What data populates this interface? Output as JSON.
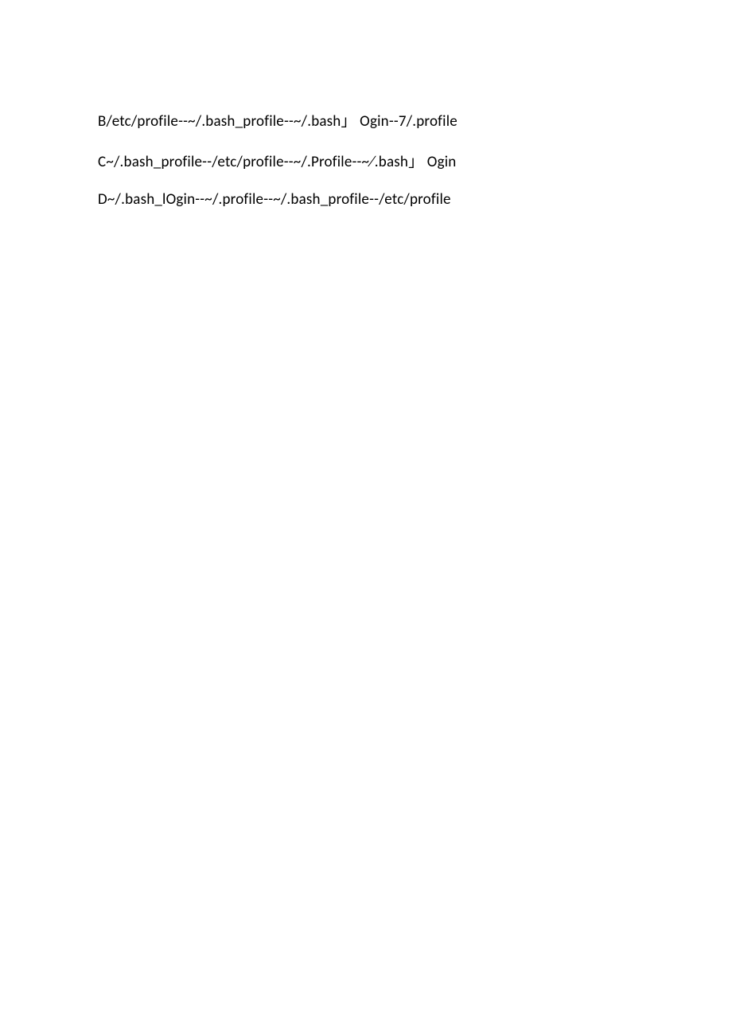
{
  "options": {
    "b": "B/etc/profile--~/.bash_profile--~/.bash」 Ogin--7/.profile",
    "c": "C~/.bash_profile--/etc/profile--~/.Profile--~⁄.bash」 Ogin",
    "d": "D~/.bash_lOgin--~/.profile--~/.bash_profile--/etc/profile"
  }
}
